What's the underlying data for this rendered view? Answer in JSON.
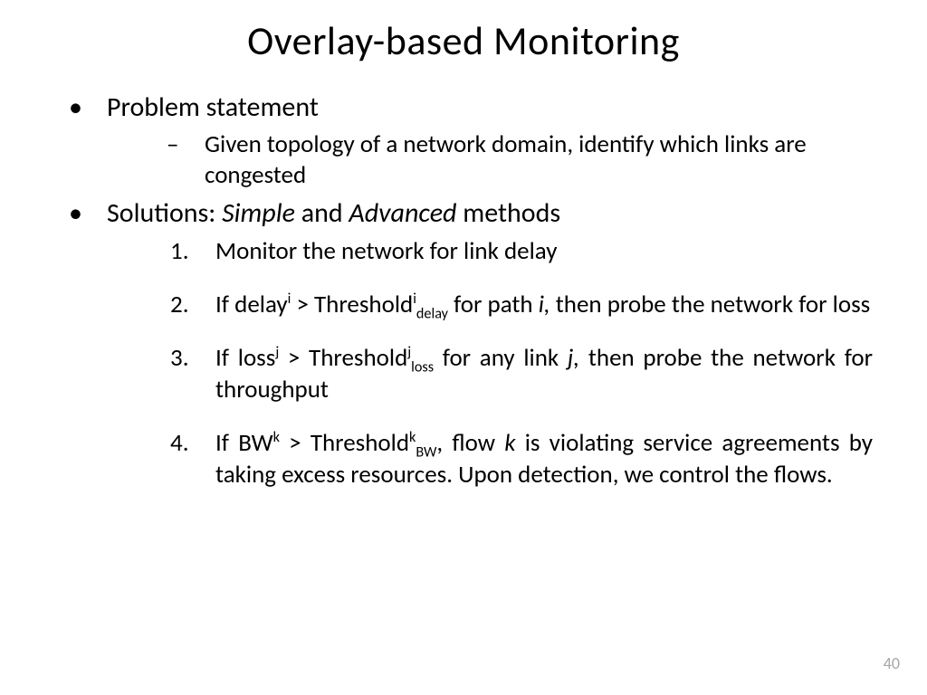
{
  "title": "Overlay-based Monitoring",
  "bullets": {
    "problem": {
      "label": "Problem statement",
      "sub": "Given topology of a network domain, identify which links are congested"
    },
    "solutions": {
      "label_pre": "Solutions: ",
      "label_simple": "Simple",
      "label_and": " and ",
      "label_advanced": "Advanced",
      "label_post": " methods",
      "items": {
        "one": "Monitor the network for link  delay",
        "two": {
          "a": "If delay",
          "sup1": "i",
          "b": " > Threshold",
          "sup2": "i",
          "sub2": "delay",
          "c": " for path ",
          "ivar": "i,",
          "d": "  then probe the network for loss"
        },
        "three": {
          "a": "If loss",
          "sup1": "j",
          "b": " > Threshold",
          "sup2": "j",
          "sub2": "loss",
          "c": " for any link ",
          "jvar": "j,",
          "d": " then probe the network for throughput"
        },
        "four": {
          "a": "If BW",
          "sup1": "k",
          "b": " > Threshold",
          "sup2": "k",
          "sub2": "BW",
          "c": ", flow ",
          "kvar": "k",
          "d": " is violating service agreements by taking excess resources. Upon detection, we control the flows."
        }
      }
    }
  },
  "page": "40"
}
